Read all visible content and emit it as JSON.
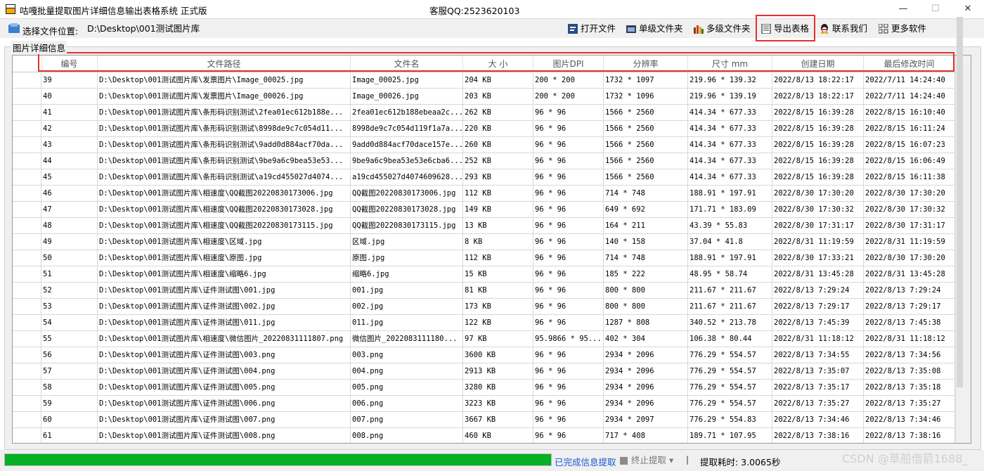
{
  "window": {
    "title": "咕嘎批量提取图片详细信息输出表格系统  正式版",
    "service": "客服QQ:2523620103",
    "min_symbol": "—",
    "max_symbol": "☐",
    "close_symbol": "✕"
  },
  "toolbar": {
    "path_label": "选择文件位置:",
    "path_value": "D:\\Desktop\\001测试图片库",
    "buttons": [
      {
        "label": "打开文件",
        "icon": "open-file-icon"
      },
      {
        "label": "单级文件夹",
        "icon": "single-folder-icon"
      },
      {
        "label": "多级文件夹",
        "icon": "multi-folder-icon"
      },
      {
        "label": "导出表格",
        "icon": "export-table-icon"
      },
      {
        "label": "联系我们",
        "icon": "contact-qq-icon"
      },
      {
        "label": "更多软件",
        "icon": "more-software-icon"
      }
    ]
  },
  "group_label": "图片详细信息",
  "table": {
    "columns": [
      "编号",
      "文件路径",
      "文件名",
      "大 小",
      "图片DPI",
      "分辨率",
      "尺寸 mm",
      "创建日期",
      "最后修改时间"
    ],
    "rows": [
      [
        "39",
        "D:\\Desktop\\001测试图片库\\发票图片\\Image_00025.jpg",
        "Image_00025.jpg",
        "204 KB",
        "200 * 200",
        "1732 * 1097",
        "219.96 * 139.32",
        "2022/8/13 18:22:17",
        "2022/7/11 14:24:40"
      ],
      [
        "40",
        "D:\\Desktop\\001测试图片库\\发票图片\\Image_00026.jpg",
        "Image_00026.jpg",
        "203 KB",
        "200 * 200",
        "1732 * 1096",
        "219.96 * 139.19",
        "2022/8/13 18:22:17",
        "2022/7/11 14:24:40"
      ],
      [
        "41",
        "D:\\Desktop\\001测试图片库\\条形码识别测试\\2fea01ec612b188e...",
        "2fea01ec612b188ebeaa2c...",
        "262 KB",
        "96 * 96",
        "1566 * 2560",
        "414.34 * 677.33",
        "2022/8/15 16:39:28",
        "2022/8/15 16:10:40"
      ],
      [
        "42",
        "D:\\Desktop\\001测试图片库\\条形码识别测试\\8998de9c7c054d11...",
        "8998de9c7c054d119f1a7a...",
        "220 KB",
        "96 * 96",
        "1566 * 2560",
        "414.34 * 677.33",
        "2022/8/15 16:39:28",
        "2022/8/15 16:11:24"
      ],
      [
        "43",
        "D:\\Desktop\\001测试图片库\\条形码识别测试\\9add0d884acf70da...",
        "9add0d884acf70dace157e...",
        "260 KB",
        "96 * 96",
        "1566 * 2560",
        "414.34 * 677.33",
        "2022/8/15 16:39:28",
        "2022/8/15 16:07:23"
      ],
      [
        "44",
        "D:\\Desktop\\001测试图片库\\条形码识别测试\\9be9a6c9bea53e53...",
        "9be9a6c9bea53e53e6cba6...",
        "252 KB",
        "96 * 96",
        "1566 * 2560",
        "414.34 * 677.33",
        "2022/8/15 16:39:28",
        "2022/8/15 16:06:49"
      ],
      [
        "45",
        "D:\\Desktop\\001测试图片库\\条形码识别测试\\a19cd455027d4074...",
        "a19cd455027d4074609628...",
        "293 KB",
        "96 * 96",
        "1566 * 2560",
        "414.34 * 677.33",
        "2022/8/15 16:39:28",
        "2022/8/15 16:11:38"
      ],
      [
        "46",
        "D:\\Desktop\\001测试图片库\\相速度\\QQ截图20220830173006.jpg",
        "QQ截图20220830173006.jpg",
        "112 KB",
        "96 * 96",
        "714 * 748",
        "188.91 * 197.91",
        "2022/8/30 17:30:20",
        "2022/8/30 17:30:20"
      ],
      [
        "47",
        "D:\\Desktop\\001测试图片库\\相速度\\QQ截图20220830173028.jpg",
        "QQ截图20220830173028.jpg",
        "149 KB",
        "96 * 96",
        "649 * 692",
        "171.71 * 183.09",
        "2022/8/30 17:30:32",
        "2022/8/30 17:30:32"
      ],
      [
        "48",
        "D:\\Desktop\\001测试图片库\\相速度\\QQ截图20220830173115.jpg",
        "QQ截图20220830173115.jpg",
        "13 KB",
        "96 * 96",
        "164 * 211",
        "43.39 * 55.83",
        "2022/8/30 17:31:17",
        "2022/8/30 17:31:17"
      ],
      [
        "49",
        "D:\\Desktop\\001测试图片库\\相速度\\区域.jpg",
        "区域.jpg",
        "8 KB",
        "96 * 96",
        "140 * 158",
        "37.04 * 41.8",
        "2022/8/31 11:19:59",
        "2022/8/31 11:19:59"
      ],
      [
        "50",
        "D:\\Desktop\\001测试图片库\\相速度\\原图.jpg",
        "原图.jpg",
        "112 KB",
        "96 * 96",
        "714 * 748",
        "188.91 * 197.91",
        "2022/8/30 17:33:21",
        "2022/8/30 17:30:20"
      ],
      [
        "51",
        "D:\\Desktop\\001测试图片库\\相速度\\缩略6.jpg",
        "缩略6.jpg",
        "15 KB",
        "96 * 96",
        "185 * 222",
        "48.95 * 58.74",
        "2022/8/31 13:45:28",
        "2022/8/31 13:45:28"
      ],
      [
        "52",
        "D:\\Desktop\\001测试图片库\\证件测试图\\001.jpg",
        "001.jpg",
        "81 KB",
        "96 * 96",
        "800 * 800",
        "211.67 * 211.67",
        "2022/8/13 7:29:24",
        "2022/8/13 7:29:24"
      ],
      [
        "53",
        "D:\\Desktop\\001测试图片库\\证件测试图\\002.jpg",
        "002.jpg",
        "173 KB",
        "96 * 96",
        "800 * 800",
        "211.67 * 211.67",
        "2022/8/13 7:29:17",
        "2022/8/13 7:29:17"
      ],
      [
        "54",
        "D:\\Desktop\\001测试图片库\\证件测试图\\011.jpg",
        "011.jpg",
        "122 KB",
        "96 * 96",
        "1287 * 808",
        "340.52 * 213.78",
        "2022/8/13 7:45:39",
        "2022/8/13 7:45:38"
      ],
      [
        "55",
        "D:\\Desktop\\001测试图片库\\相速度\\微信图片_20220831111807.png",
        "微信图片_2022083111180...",
        "97 KB",
        "95.9866 * 95...",
        "402 * 304",
        "106.38 * 80.44",
        "2022/8/31 11:18:12",
        "2022/8/31 11:18:12"
      ],
      [
        "56",
        "D:\\Desktop\\001测试图片库\\证件测试图\\003.png",
        "003.png",
        "3600 KB",
        "96 * 96",
        "2934 * 2096",
        "776.29 * 554.57",
        "2022/8/13 7:34:55",
        "2022/8/13 7:34:56"
      ],
      [
        "57",
        "D:\\Desktop\\001测试图片库\\证件测试图\\004.png",
        "004.png",
        "2913 KB",
        "96 * 96",
        "2934 * 2096",
        "776.29 * 554.57",
        "2022/8/13 7:35:07",
        "2022/8/13 7:35:08"
      ],
      [
        "58",
        "D:\\Desktop\\001测试图片库\\证件测试图\\005.png",
        "005.png",
        "3280 KB",
        "96 * 96",
        "2934 * 2096",
        "776.29 * 554.57",
        "2022/8/13 7:35:17",
        "2022/8/13 7:35:18"
      ],
      [
        "59",
        "D:\\Desktop\\001测试图片库\\证件测试图\\006.png",
        "006.png",
        "3223 KB",
        "96 * 96",
        "2934 * 2096",
        "776.29 * 554.57",
        "2022/8/13 7:35:27",
        "2022/8/13 7:35:27"
      ],
      [
        "60",
        "D:\\Desktop\\001测试图片库\\证件测试图\\007.png",
        "007.png",
        "3667 KB",
        "96 * 96",
        "2934 * 2097",
        "776.29 * 554.83",
        "2022/8/13 7:34:46",
        "2022/8/13 7:34:46"
      ],
      [
        "61",
        "D:\\Desktop\\001测试图片库\\证件测试图\\008.png",
        "008.png",
        "460 KB",
        "96 * 96",
        "717 * 408",
        "189.71 * 107.95",
        "2022/8/13 7:38:16",
        "2022/8/13 7:38:16"
      ]
    ]
  },
  "status": {
    "progress_fraction": 1.0,
    "progress_color": "#06b025",
    "status_text": "已完成信息提取",
    "stop_label": "终止提取",
    "stop_arrow": "▾",
    "separator": "|",
    "elapsed": "提取耗时: 3.0065秒"
  },
  "watermark": "CSDN @草船借箭1688_",
  "colors": {
    "highlight": "#e53030",
    "status_blue": "#1a56d6"
  }
}
